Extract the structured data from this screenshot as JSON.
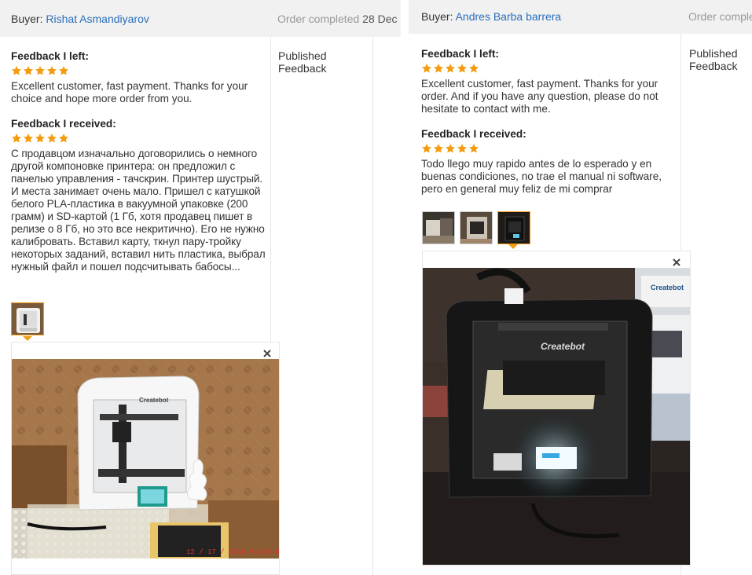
{
  "orders": [
    {
      "buyer_label": "Buyer:",
      "buyer_name": "Rishat Asmandiyarov",
      "status": "Order completed",
      "date": "28 Dec",
      "left_heading": "Feedback I left:",
      "left_rating": 5,
      "left_text": "Excellent customer, fast payment. Thanks for your choice and hope more order from you.",
      "received_heading": "Feedback I received:",
      "received_rating": 5,
      "received_text": "С продавцом изначально договорились о немного другой компоновке принтера: он предложил с панелью управления - тачскрин. Принтер шустрый. И места занимает очень мало. Пришел с катушкой белого PLA-пластика в вакуумной упаковке (200 грамм) и SD-картой (1 Гб, хотя продавец пишет в релизе о 8 Гб, но это все некритично). Его не нужно калибровать. Вставил карту, ткнул пару-тройку некоторых заданий, вставил нить пластика, выбрал нужный файл и пошел подсчитывать бабосы...",
      "publish_status": "Published Feedback",
      "photo_count": 1,
      "photo_label": "Createbot",
      "photo_timestamp": "12 / 17 / 2016  00:00:00"
    },
    {
      "buyer_label": "Buyer:",
      "buyer_name": "Andres Barba barrera",
      "status": "Order comple",
      "date": "",
      "left_heading": "Feedback I left:",
      "left_rating": 5,
      "left_text": "Excellent customer, fast payment. Thanks for your order. And if you have any question, please do not hesitate to contact with me.",
      "received_heading": "Feedback I received:",
      "received_rating": 5,
      "received_text": "Todo llego muy rapido antes de lo esperado y en buenas condiciones, no trae el manual ni software, pero en general muy feliz de mi comprar",
      "publish_status": "Published Feedback",
      "photo_count": 3,
      "photo_label": "Createbot",
      "box_label": "Createbot"
    }
  ],
  "colors": {
    "link": "#2a6ebb",
    "star": "#f39c12",
    "header_bg": "#f1f1f1",
    "muted": "#999999"
  },
  "icons": {
    "rating": "star-icon",
    "close": "close-icon"
  }
}
